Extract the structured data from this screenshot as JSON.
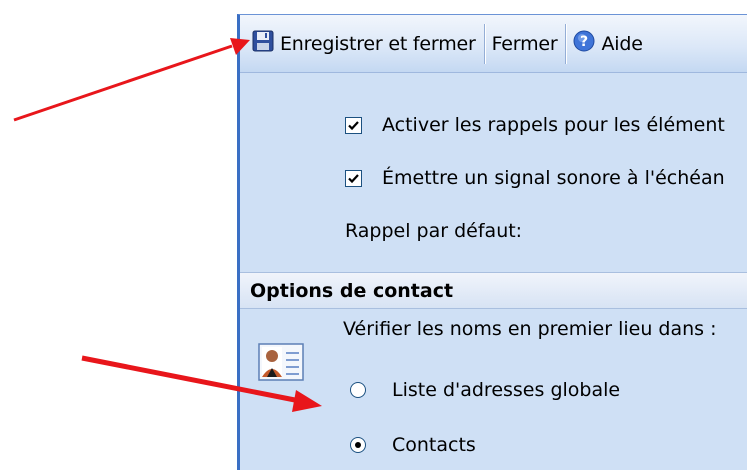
{
  "toolbar": {
    "save_close_label": "Enregistrer et fermer",
    "close_label": "Fermer",
    "help_label": "Aide"
  },
  "reminders": {
    "enable_reminders": {
      "label": "Activer les rappels pour les élément",
      "checked": true
    },
    "play_sound": {
      "label": "Émettre un signal sonore à l'échéan",
      "checked": true
    },
    "default_reminder_label": "Rappel par défaut:"
  },
  "contact_options": {
    "header": "Options de contact",
    "check_names_label": "Vérifier les noms en premier lieu dans :",
    "options": [
      {
        "label": "Liste d'adresses globale",
        "selected": false
      },
      {
        "label": "Contacts",
        "selected": true
      }
    ]
  },
  "colors": {
    "panel_bg": "#cfe0f5",
    "window_border": "#3a6fc4",
    "annotation_arrow": "#e8161b"
  },
  "icons": [
    "floppy-disk-save-icon",
    "help-icon",
    "contact-card-icon",
    "red-annotation-arrow"
  ]
}
